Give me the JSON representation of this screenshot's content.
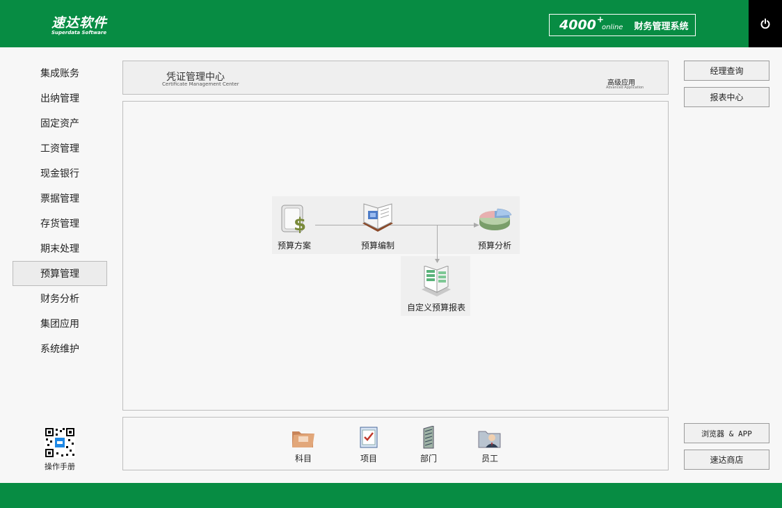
{
  "brand": {
    "name_cn": "速达软件",
    "name_en": "Superdata Software"
  },
  "system": {
    "version": "4000",
    "plus": "+",
    "edition": "online",
    "name": "财务管理系统"
  },
  "sidebar": {
    "items": [
      {
        "label": "集成账务"
      },
      {
        "label": "出纳管理"
      },
      {
        "label": "固定资产"
      },
      {
        "label": "工资管理"
      },
      {
        "label": "现金银行"
      },
      {
        "label": "票据管理"
      },
      {
        "label": "存货管理"
      },
      {
        "label": "期末处理"
      },
      {
        "label": "预算管理",
        "active": true
      },
      {
        "label": "财务分析"
      },
      {
        "label": "集团应用"
      },
      {
        "label": "系统维护"
      }
    ],
    "manual_label": "操作手册"
  },
  "header": {
    "title": "凭证管理中心",
    "subtitle": "Certificate Management Center",
    "advanced": "高级应用",
    "advanced_en": "Advanced Application"
  },
  "flow": {
    "plan": "预算方案",
    "edit": "预算编制",
    "analysis": "预算分析",
    "custom_report": "自定义预算报表"
  },
  "tools": {
    "subject": "科目",
    "project": "项目",
    "department": "部门",
    "employee": "员工"
  },
  "right": {
    "manager_query": "经理查询",
    "report_center": "报表中心",
    "browser_app": "浏览器 & APP",
    "store": "速达商店"
  },
  "colors": {
    "brand_green": "#078c43",
    "power_bg": "#000000"
  }
}
